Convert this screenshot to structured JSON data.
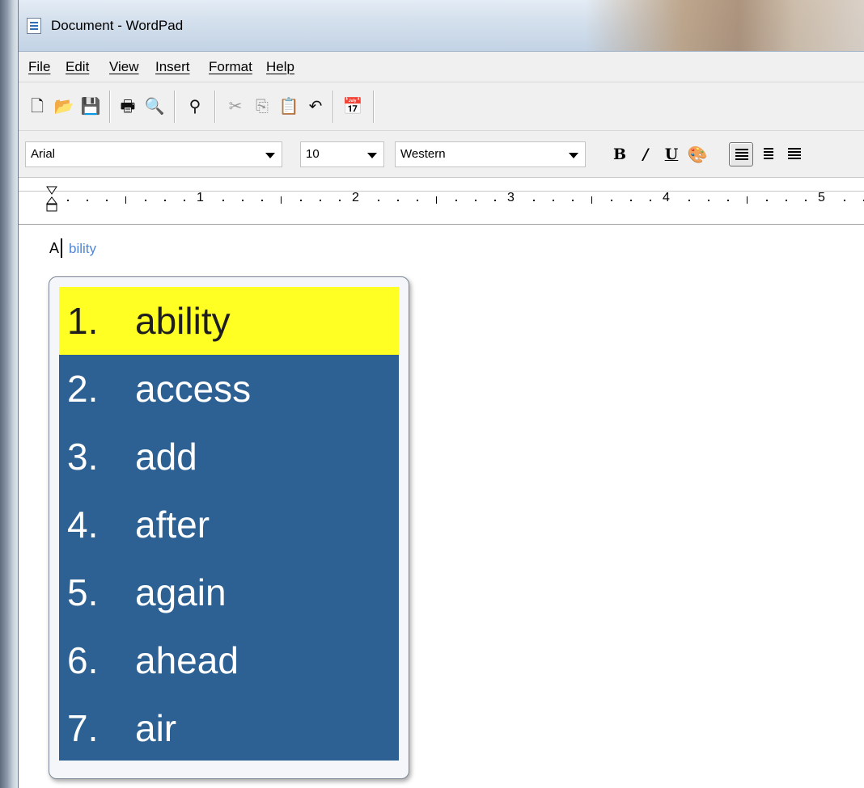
{
  "window": {
    "title": "Document - WordPad"
  },
  "menu": {
    "items": [
      "File",
      "Edit",
      "View",
      "Insert",
      "Format",
      "Help"
    ]
  },
  "toolbar": {
    "icons": [
      "new-icon",
      "open-icon",
      "save-icon",
      "print-icon",
      "print-preview-icon",
      "find-icon",
      "cut-icon",
      "copy-icon",
      "paste-icon",
      "undo-icon",
      "insert-date-time-icon"
    ]
  },
  "format": {
    "font": "Arial",
    "size": "10",
    "script": "Western",
    "bold": "B",
    "italic": "/",
    "underline": "U"
  },
  "ruler": {
    "numbers": [
      "1",
      "2",
      "3",
      "4",
      "5"
    ]
  },
  "document": {
    "typed_text": "A",
    "inline_suggestion": "bility"
  },
  "predictions": {
    "selected_index": 0,
    "items": [
      {
        "number": "1.",
        "word": "ability"
      },
      {
        "number": "2.",
        "word": "access"
      },
      {
        "number": "3.",
        "word": "add"
      },
      {
        "number": "4.",
        "word": "after"
      },
      {
        "number": "5.",
        "word": "again"
      },
      {
        "number": "6.",
        "word": "ahead"
      },
      {
        "number": "7.",
        "word": "air"
      }
    ]
  },
  "colors": {
    "prediction_bg": "#2e6193",
    "prediction_selected": "#ffff24",
    "inline_suggestion": "#4f86d6"
  }
}
